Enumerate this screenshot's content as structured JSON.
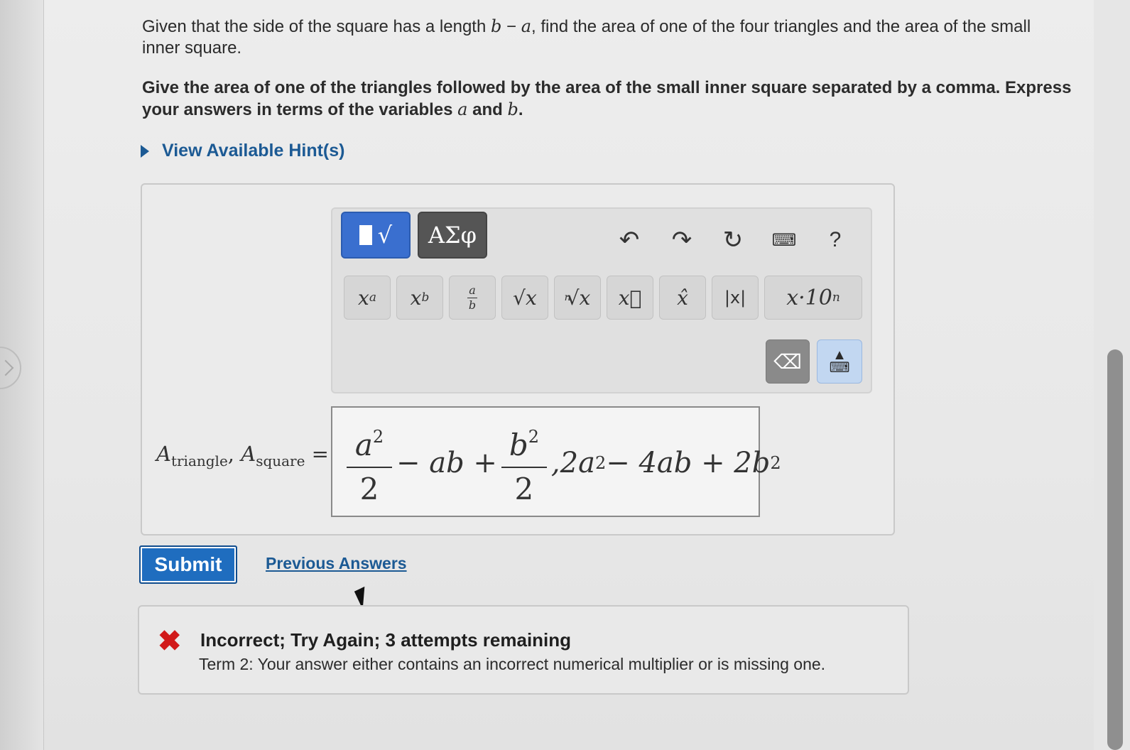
{
  "question": {
    "part1_a": "Given that the side of the square has a length ",
    "part1_b": "b",
    "part1_c": " − ",
    "part1_d": "a",
    "part1_e": ", find the area of one of the four triangles and the area of the small inner square.",
    "part2_a": "Give the area of one of the triangles followed by the area of the small inner square separated by a comma. Express your answers in terms of the variables ",
    "part2_var1": "a",
    "part2_and": " and ",
    "part2_var2": "b",
    "part2_end": "."
  },
  "hint": {
    "label": "View Available Hint(s)"
  },
  "toolbar": {
    "templates_tab_sqrt": "√",
    "symbols_tab": "ΑΣφ",
    "undo_icon": "↶",
    "redo_icon": "↷",
    "reset_icon": "↻",
    "keyboard_icon": "⌨",
    "help_label": "?"
  },
  "math_buttons": {
    "power_base": "x",
    "power_exp": "a",
    "sub_base": "x",
    "sub_idx": "b",
    "frac_num": "a",
    "frac_den": "b",
    "sqrt": "√x",
    "nthroot_n": "n",
    "nthroot": "√x",
    "vector": "x⃗",
    "hat": "x̂",
    "abs": "|x|",
    "sci_a": "x·10",
    "sci_exp": "n",
    "backspace_icon": "⌫",
    "keyboard_toggle_arrow": "▲",
    "keyboard_toggle_icon": "⌨"
  },
  "answer": {
    "label_A1": "A",
    "label_sub1": "triangle",
    "label_comma": ", ",
    "label_A2": "A",
    "label_sub2": "square",
    "label_eq": " =",
    "frac1_num": "a",
    "frac1_num_exp": "2",
    "frac1_den": "2",
    "mid1": "− ab +",
    "frac2_num": "b",
    "frac2_num_exp": "2",
    "frac2_den": "2",
    "tail_a": ",2a",
    "tail_a_exp": "2",
    "tail_b": " − 4ab + 2b",
    "tail_b_exp": "2"
  },
  "actions": {
    "submit_label": "Submit",
    "previous_answers_label": "Previous Answers"
  },
  "feedback": {
    "icon": "✖",
    "title": "Incorrect; Try Again; 3 attempts remaining",
    "detail": "Term 2: Your answer either contains an incorrect numerical multiplier or is missing one."
  },
  "colors": {
    "link": "#1c5a94",
    "submit": "#1f6dbf",
    "templates_tab": "#3a6fcf",
    "error": "#d11919"
  }
}
